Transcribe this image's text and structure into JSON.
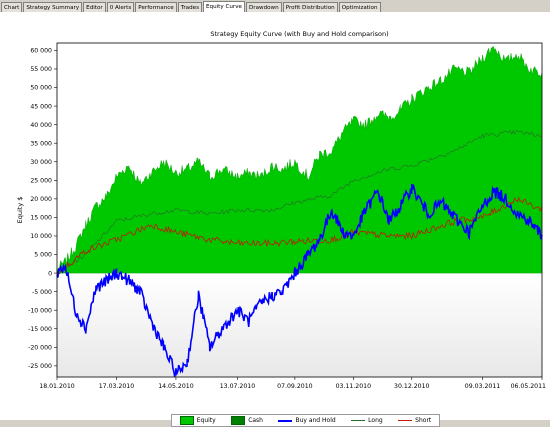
{
  "tabs": [
    {
      "label": "Chart",
      "active": false
    },
    {
      "label": "Strategy Summary",
      "active": false
    },
    {
      "label": "Editor",
      "active": false
    },
    {
      "label": "0 Alerts",
      "active": false
    },
    {
      "label": "Performance",
      "active": false
    },
    {
      "label": "Trades",
      "active": false
    },
    {
      "label": "Equity Curve",
      "active": true
    },
    {
      "label": "Drawdown",
      "active": false
    },
    {
      "label": "Profit Distribution",
      "active": false
    },
    {
      "label": "Optimization",
      "active": false
    }
  ],
  "chart_data": {
    "type": "area",
    "title": "Strategy Equity Curve (with Buy and Hold comparison)",
    "ylabel": "Equity $",
    "xlabel": "",
    "ylim": [
      -28000,
      62000
    ],
    "yticks": [
      60000,
      55000,
      50000,
      45000,
      40000,
      35000,
      30000,
      25000,
      20000,
      15000,
      10000,
      5000,
      0,
      -5000,
      -10000,
      -15000,
      -20000,
      -25000
    ],
    "ytick_labels": [
      "60 000",
      "55 000",
      "50 000",
      "45 000",
      "40 000",
      "35 000",
      "30 000",
      "25 000",
      "20 000",
      "15 000",
      "10 000",
      "5 000",
      "0",
      "-5 000",
      "-10 000",
      "-15 000",
      "-20 000",
      "-25 000"
    ],
    "xlim": [
      "2010-01-18",
      "2011-05-06"
    ],
    "xticks": [
      "2010-01-18",
      "2010-03-17",
      "2010-05-14",
      "2010-07-13",
      "2010-09-07",
      "2010-11-03",
      "2010-12-30",
      "2011-03-09",
      "2011-05-06"
    ],
    "xtick_labels": [
      "18.01.2010",
      "17.03.2010",
      "14.05.2010",
      "13.07.2010",
      "07.09.2010",
      "03.11.2010",
      "30.12.2010",
      "09.03.2011",
      "06.05.2011"
    ],
    "grid": false,
    "legend_position": "bottom",
    "series": [
      {
        "name": "Equity",
        "style": "area",
        "color": "#00c800",
        "x": [
          "2010-01-18",
          "2010-01-26",
          "2010-02-05",
          "2010-02-15",
          "2010-02-25",
          "2010-03-08",
          "2010-03-17",
          "2010-03-29",
          "2010-04-09",
          "2010-04-20",
          "2010-05-02",
          "2010-05-14",
          "2010-05-25",
          "2010-06-05",
          "2010-06-16",
          "2010-06-28",
          "2010-07-13",
          "2010-07-24",
          "2010-08-05",
          "2010-08-16",
          "2010-08-26",
          "2010-09-07",
          "2010-09-20",
          "2010-10-01",
          "2010-10-13",
          "2010-10-24",
          "2010-11-03",
          "2010-11-15",
          "2010-11-27",
          "2010-12-08",
          "2010-12-19",
          "2010-12-30",
          "2011-01-15",
          "2011-01-28",
          "2011-02-10",
          "2011-02-24",
          "2011-03-09",
          "2011-03-20",
          "2011-04-01",
          "2011-04-12",
          "2011-04-24",
          "2011-05-06"
        ],
        "values": [
          1000,
          3000,
          7000,
          13000,
          18000,
          21000,
          26000,
          29000,
          24000,
          27000,
          30000,
          27000,
          28000,
          30000,
          26000,
          28000,
          26000,
          27000,
          26000,
          29000,
          28000,
          30000,
          26000,
          32000,
          33000,
          38000,
          41000,
          40000,
          43000,
          42000,
          44000,
          47000,
          50000,
          52000,
          55000,
          54000,
          58000,
          61000,
          57000,
          59000,
          55000,
          54000
        ]
      },
      {
        "name": "Cash",
        "style": "area",
        "color": "#008000",
        "x": [],
        "values": []
      },
      {
        "name": "Buy and Hold",
        "style": "line",
        "color": "#0000ff",
        "x": [
          "2010-01-18",
          "2010-01-26",
          "2010-02-05",
          "2010-02-15",
          "2010-02-25",
          "2010-03-08",
          "2010-03-17",
          "2010-03-29",
          "2010-04-09",
          "2010-04-20",
          "2010-05-02",
          "2010-05-14",
          "2010-05-25",
          "2010-06-05",
          "2010-06-16",
          "2010-06-28",
          "2010-07-13",
          "2010-07-24",
          "2010-08-05",
          "2010-08-16",
          "2010-08-26",
          "2010-09-07",
          "2010-09-20",
          "2010-10-01",
          "2010-10-13",
          "2010-10-24",
          "2010-11-03",
          "2010-11-15",
          "2010-11-27",
          "2010-12-08",
          "2010-12-19",
          "2010-12-30",
          "2011-01-15",
          "2011-01-28",
          "2011-02-10",
          "2011-02-24",
          "2011-03-09",
          "2011-03-20",
          "2011-04-01",
          "2011-04-12",
          "2011-04-24",
          "2011-05-06"
        ],
        "values": [
          0,
          2000,
          -10000,
          -15000,
          -4000,
          -2000,
          0,
          -2000,
          -5000,
          -13000,
          -20000,
          -27000,
          -24000,
          -6000,
          -20000,
          -15000,
          -10000,
          -13000,
          -8000,
          -6000,
          -5000,
          0,
          5000,
          9000,
          17000,
          11000,
          10000,
          17000,
          22000,
          14000,
          18000,
          23000,
          16000,
          19000,
          15000,
          11000,
          18000,
          22000,
          20000,
          16000,
          14000,
          10000
        ]
      },
      {
        "name": "Long",
        "style": "line",
        "color": "#2a6a2a",
        "x": [
          "2010-01-18",
          "2010-02-15",
          "2010-03-17",
          "2010-04-20",
          "2010-05-14",
          "2010-06-16",
          "2010-07-13",
          "2010-08-16",
          "2010-09-07",
          "2010-10-13",
          "2010-11-03",
          "2010-12-08",
          "2010-12-30",
          "2011-02-10",
          "2011-03-09",
          "2011-04-12",
          "2011-05-06"
        ],
        "values": [
          0,
          5000,
          14000,
          16000,
          17000,
          16000,
          17000,
          17000,
          19000,
          21000,
          25000,
          28000,
          29000,
          33000,
          37000,
          38000,
          37000
        ]
      },
      {
        "name": "Short",
        "style": "line",
        "color": "#c01a00",
        "x": [
          "2010-01-18",
          "2010-02-15",
          "2010-03-17",
          "2010-04-20",
          "2010-05-14",
          "2010-06-16",
          "2010-07-13",
          "2010-08-16",
          "2010-09-07",
          "2010-10-13",
          "2010-11-03",
          "2010-12-08",
          "2010-12-30",
          "2011-02-10",
          "2011-03-09",
          "2011-04-12",
          "2011-05-06"
        ],
        "values": [
          0,
          6000,
          9000,
          13000,
          11000,
          9000,
          8000,
          8000,
          8500,
          9000,
          11000,
          10000,
          10000,
          14000,
          15000,
          20000,
          17000
        ]
      }
    ]
  }
}
